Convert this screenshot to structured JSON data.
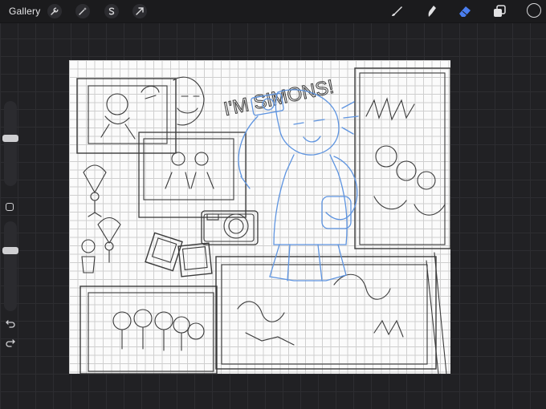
{
  "toolbar": {
    "gallery_label": "Gallery",
    "left_tools": [
      "wrench-icon",
      "magic-wand-icon",
      "selection-s-icon",
      "move-arrow-icon"
    ],
    "right_tools": [
      "brush-icon",
      "smudge-icon",
      "eraser-icon",
      "layers-icon"
    ],
    "active_tool": "eraser-icon",
    "active_color": "#4a7ef0",
    "current_color": "#1b1b1d"
  },
  "sidebar": {
    "brush_size_level": 0.14,
    "opacity_level": 0.27
  },
  "canvas": {
    "sketch_text": "I'M SIMONS!"
  }
}
